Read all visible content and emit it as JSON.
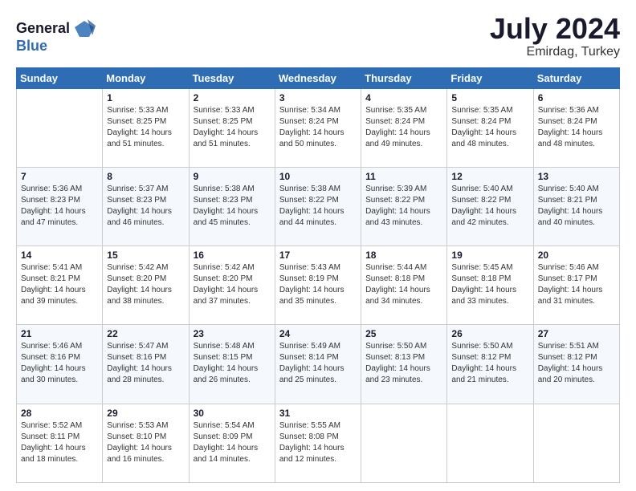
{
  "logo": {
    "line1": "General",
    "line2": "Blue"
  },
  "header": {
    "month_year": "July 2024",
    "subtitle": "Emirdag, Turkey"
  },
  "weekdays": [
    "Sunday",
    "Monday",
    "Tuesday",
    "Wednesday",
    "Thursday",
    "Friday",
    "Saturday"
  ],
  "weeks": [
    [
      {
        "day": "",
        "info": ""
      },
      {
        "day": "1",
        "info": "Sunrise: 5:33 AM\nSunset: 8:25 PM\nDaylight: 14 hours\nand 51 minutes."
      },
      {
        "day": "2",
        "info": "Sunrise: 5:33 AM\nSunset: 8:25 PM\nDaylight: 14 hours\nand 51 minutes."
      },
      {
        "day": "3",
        "info": "Sunrise: 5:34 AM\nSunset: 8:24 PM\nDaylight: 14 hours\nand 50 minutes."
      },
      {
        "day": "4",
        "info": "Sunrise: 5:35 AM\nSunset: 8:24 PM\nDaylight: 14 hours\nand 49 minutes."
      },
      {
        "day": "5",
        "info": "Sunrise: 5:35 AM\nSunset: 8:24 PM\nDaylight: 14 hours\nand 48 minutes."
      },
      {
        "day": "6",
        "info": "Sunrise: 5:36 AM\nSunset: 8:24 PM\nDaylight: 14 hours\nand 48 minutes."
      }
    ],
    [
      {
        "day": "7",
        "info": "Sunrise: 5:36 AM\nSunset: 8:23 PM\nDaylight: 14 hours\nand 47 minutes."
      },
      {
        "day": "8",
        "info": "Sunrise: 5:37 AM\nSunset: 8:23 PM\nDaylight: 14 hours\nand 46 minutes."
      },
      {
        "day": "9",
        "info": "Sunrise: 5:38 AM\nSunset: 8:23 PM\nDaylight: 14 hours\nand 45 minutes."
      },
      {
        "day": "10",
        "info": "Sunrise: 5:38 AM\nSunset: 8:22 PM\nDaylight: 14 hours\nand 44 minutes."
      },
      {
        "day": "11",
        "info": "Sunrise: 5:39 AM\nSunset: 8:22 PM\nDaylight: 14 hours\nand 43 minutes."
      },
      {
        "day": "12",
        "info": "Sunrise: 5:40 AM\nSunset: 8:22 PM\nDaylight: 14 hours\nand 42 minutes."
      },
      {
        "day": "13",
        "info": "Sunrise: 5:40 AM\nSunset: 8:21 PM\nDaylight: 14 hours\nand 40 minutes."
      }
    ],
    [
      {
        "day": "14",
        "info": "Sunrise: 5:41 AM\nSunset: 8:21 PM\nDaylight: 14 hours\nand 39 minutes."
      },
      {
        "day": "15",
        "info": "Sunrise: 5:42 AM\nSunset: 8:20 PM\nDaylight: 14 hours\nand 38 minutes."
      },
      {
        "day": "16",
        "info": "Sunrise: 5:42 AM\nSunset: 8:20 PM\nDaylight: 14 hours\nand 37 minutes."
      },
      {
        "day": "17",
        "info": "Sunrise: 5:43 AM\nSunset: 8:19 PM\nDaylight: 14 hours\nand 35 minutes."
      },
      {
        "day": "18",
        "info": "Sunrise: 5:44 AM\nSunset: 8:18 PM\nDaylight: 14 hours\nand 34 minutes."
      },
      {
        "day": "19",
        "info": "Sunrise: 5:45 AM\nSunset: 8:18 PM\nDaylight: 14 hours\nand 33 minutes."
      },
      {
        "day": "20",
        "info": "Sunrise: 5:46 AM\nSunset: 8:17 PM\nDaylight: 14 hours\nand 31 minutes."
      }
    ],
    [
      {
        "day": "21",
        "info": "Sunrise: 5:46 AM\nSunset: 8:16 PM\nDaylight: 14 hours\nand 30 minutes."
      },
      {
        "day": "22",
        "info": "Sunrise: 5:47 AM\nSunset: 8:16 PM\nDaylight: 14 hours\nand 28 minutes."
      },
      {
        "day": "23",
        "info": "Sunrise: 5:48 AM\nSunset: 8:15 PM\nDaylight: 14 hours\nand 26 minutes."
      },
      {
        "day": "24",
        "info": "Sunrise: 5:49 AM\nSunset: 8:14 PM\nDaylight: 14 hours\nand 25 minutes."
      },
      {
        "day": "25",
        "info": "Sunrise: 5:50 AM\nSunset: 8:13 PM\nDaylight: 14 hours\nand 23 minutes."
      },
      {
        "day": "26",
        "info": "Sunrise: 5:50 AM\nSunset: 8:12 PM\nDaylight: 14 hours\nand 21 minutes."
      },
      {
        "day": "27",
        "info": "Sunrise: 5:51 AM\nSunset: 8:12 PM\nDaylight: 14 hours\nand 20 minutes."
      }
    ],
    [
      {
        "day": "28",
        "info": "Sunrise: 5:52 AM\nSunset: 8:11 PM\nDaylight: 14 hours\nand 18 minutes."
      },
      {
        "day": "29",
        "info": "Sunrise: 5:53 AM\nSunset: 8:10 PM\nDaylight: 14 hours\nand 16 minutes."
      },
      {
        "day": "30",
        "info": "Sunrise: 5:54 AM\nSunset: 8:09 PM\nDaylight: 14 hours\nand 14 minutes."
      },
      {
        "day": "31",
        "info": "Sunrise: 5:55 AM\nSunset: 8:08 PM\nDaylight: 14 hours\nand 12 minutes."
      },
      {
        "day": "",
        "info": ""
      },
      {
        "day": "",
        "info": ""
      },
      {
        "day": "",
        "info": ""
      }
    ]
  ]
}
